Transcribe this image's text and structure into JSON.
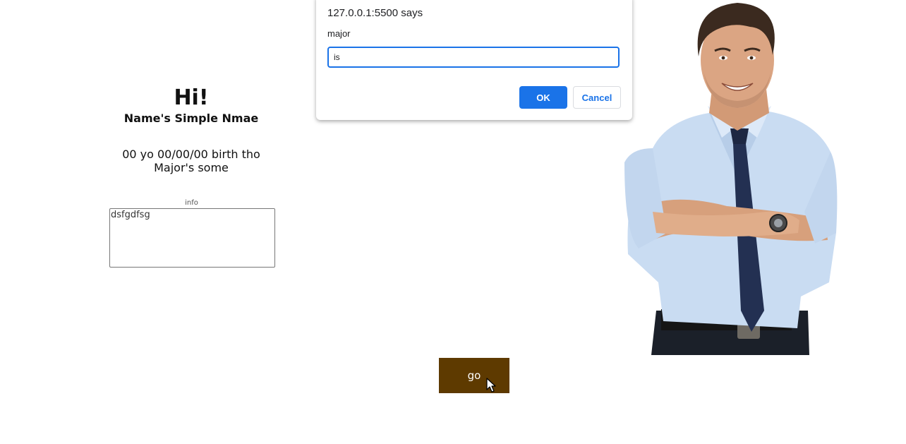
{
  "profile": {
    "greeting": "Hi!",
    "name": "Name's Simple Nmae",
    "details_line1": "00 yo 00/00/00 birth tho",
    "details_line2": "Major's some",
    "info_label": "info",
    "info_value": "dsfgdfsg"
  },
  "go_button": {
    "label": "go",
    "color": "#5e3a00"
  },
  "portrait": {
    "icon": "business-man-photo"
  },
  "dialog": {
    "origin": "127.0.0.1:5500 says",
    "message": "major",
    "input_value": "is",
    "ok_label": "OK",
    "cancel_label": "Cancel",
    "accent_color": "#1a73e8"
  }
}
